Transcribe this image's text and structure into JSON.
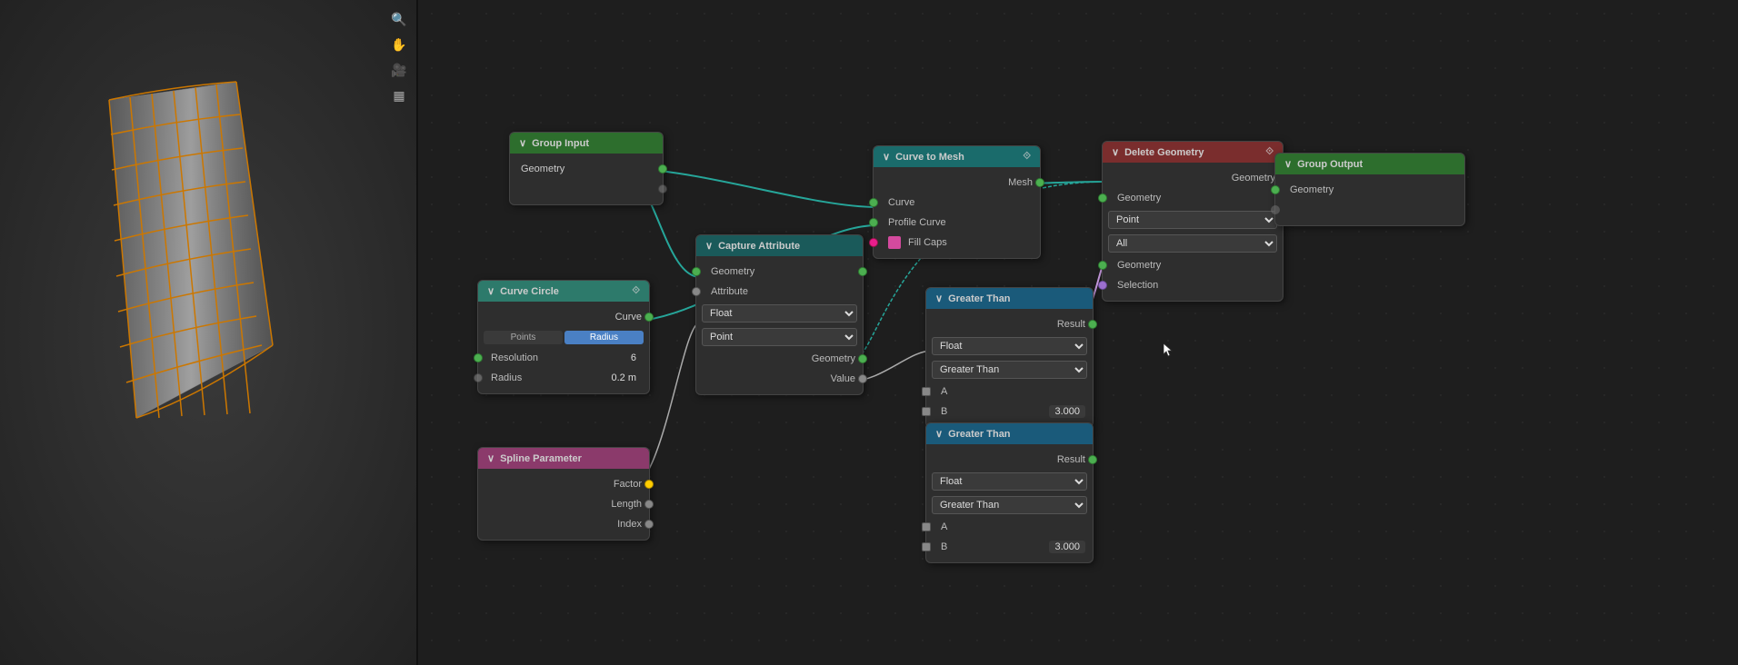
{
  "viewport": {
    "toolbar_icons": [
      "🔍",
      "✋",
      "🎥",
      "▦"
    ]
  },
  "nodes": {
    "group_input": {
      "title": "Group Input",
      "outputs": [
        {
          "label": "Geometry",
          "socket": "green"
        }
      ]
    },
    "curve_circle": {
      "title": "Curve Circle",
      "tabs": [
        "Points",
        "Radius"
      ],
      "active_tab": "Radius",
      "outputs": [
        {
          "label": "Curve",
          "socket": "green"
        }
      ],
      "fields": [
        {
          "label": "Resolution",
          "value": "6"
        },
        {
          "label": "Radius",
          "value": "0.2 m"
        }
      ]
    },
    "spline_param": {
      "title": "Spline Parameter",
      "outputs": [
        {
          "label": "Factor",
          "socket": "yellow"
        },
        {
          "label": "Length",
          "socket": "gray"
        },
        {
          "label": "Index",
          "socket": "gray"
        }
      ]
    },
    "capture_attribute": {
      "title": "Capture Attribute",
      "inputs": [
        {
          "label": "Geometry",
          "socket": "green"
        },
        {
          "label": "Attribute",
          "socket": "gray"
        }
      ],
      "dropdowns": [
        "Float",
        "Point"
      ],
      "outputs": [
        {
          "label": "Geometry",
          "socket": "green"
        },
        {
          "label": "Value",
          "socket": "gray"
        }
      ]
    },
    "curve_to_mesh": {
      "title": "Curve to Mesh",
      "inputs": [
        {
          "label": "Curve",
          "socket": "green"
        },
        {
          "label": "Profile Curve",
          "socket": "green"
        },
        {
          "label": "Fill Caps",
          "socket": "pink"
        }
      ],
      "outputs": [
        {
          "label": "Mesh",
          "socket": "green"
        }
      ]
    },
    "greater_than_1": {
      "title": "Greater Than",
      "outputs": [
        {
          "label": "Result",
          "socket": "green"
        }
      ],
      "dropdowns": [
        "Float",
        "Greater Than"
      ],
      "inputs": [
        {
          "label": "A",
          "socket": "gray"
        },
        {
          "label": "B",
          "value": "3.000",
          "socket": "gray"
        }
      ]
    },
    "greater_than_2": {
      "title": "Greater Than",
      "outputs": [
        {
          "label": "Result",
          "socket": "green"
        }
      ],
      "dropdowns": [
        "Float",
        "Greater Than"
      ],
      "inputs": [
        {
          "label": "A",
          "socket": "gray"
        },
        {
          "label": "B",
          "value": "3.000",
          "socket": "gray"
        }
      ]
    },
    "delete_geometry": {
      "title": "Delete Geometry",
      "inputs": [
        {
          "label": "Geometry",
          "socket": "green"
        },
        {
          "label": "Selection",
          "socket": "purple"
        }
      ],
      "dropdowns": [
        "Point",
        "All"
      ],
      "outputs": [
        {
          "label": "Geometry",
          "socket": "green"
        }
      ]
    },
    "group_output": {
      "title": "Group Output",
      "inputs": [
        {
          "label": "Geometry",
          "socket": "green"
        }
      ]
    }
  },
  "colors": {
    "teal": "#1a6b6b",
    "green": "#2d6e2d",
    "pink": "#8b3a6b",
    "blue": "#2d4a7a",
    "dark_teal": "#1d5a5a",
    "red": "#7a2d2d",
    "wire_teal": "#26a69a",
    "wire_gray": "#aaa"
  }
}
